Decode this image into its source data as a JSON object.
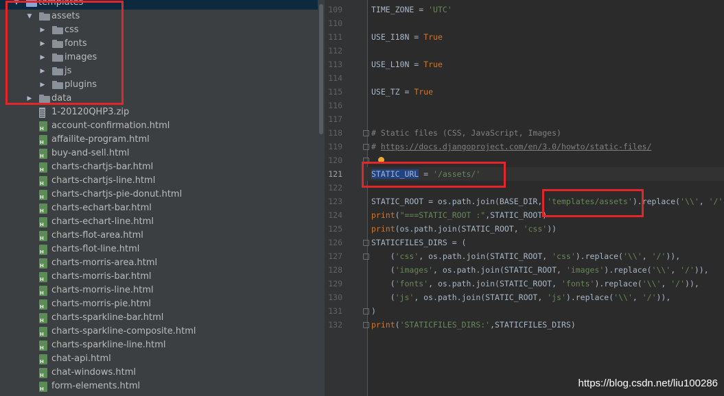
{
  "file_tree": {
    "items": [
      {
        "label": "templates",
        "type": "folder",
        "expanded": true,
        "depth": 0,
        "selected": true
      },
      {
        "label": "assets",
        "type": "folder",
        "expanded": true,
        "depth": 1
      },
      {
        "label": "css",
        "type": "folder",
        "expanded": false,
        "depth": 2
      },
      {
        "label": "fonts",
        "type": "folder",
        "expanded": false,
        "depth": 2
      },
      {
        "label": "images",
        "type": "folder",
        "expanded": false,
        "depth": 2
      },
      {
        "label": "js",
        "type": "folder",
        "expanded": false,
        "depth": 2
      },
      {
        "label": "plugins",
        "type": "folder",
        "expanded": false,
        "depth": 2
      },
      {
        "label": "data",
        "type": "folder",
        "expanded": false,
        "depth": 1
      },
      {
        "label": "1-20120QHP3.zip",
        "type": "zip",
        "depth": 1
      },
      {
        "label": "account-confirmation.html",
        "type": "html",
        "depth": 1
      },
      {
        "label": "affailite-program.html",
        "type": "html",
        "depth": 1
      },
      {
        "label": "buy-and-sell.html",
        "type": "html",
        "depth": 1
      },
      {
        "label": "charts-chartjs-bar.html",
        "type": "html",
        "depth": 1
      },
      {
        "label": "charts-chartjs-line.html",
        "type": "html",
        "depth": 1
      },
      {
        "label": "charts-chartjs-pie-donut.html",
        "type": "html",
        "depth": 1
      },
      {
        "label": "charts-echart-bar.html",
        "type": "html",
        "depth": 1
      },
      {
        "label": "charts-echart-line.html",
        "type": "html",
        "depth": 1
      },
      {
        "label": "charts-flot-area.html",
        "type": "html",
        "depth": 1
      },
      {
        "label": "charts-flot-line.html",
        "type": "html",
        "depth": 1
      },
      {
        "label": "charts-morris-area.html",
        "type": "html",
        "depth": 1
      },
      {
        "label": "charts-morris-bar.html",
        "type": "html",
        "depth": 1
      },
      {
        "label": "charts-morris-line.html",
        "type": "html",
        "depth": 1
      },
      {
        "label": "charts-morris-pie.html",
        "type": "html",
        "depth": 1
      },
      {
        "label": "charts-sparkline-bar.html",
        "type": "html",
        "depth": 1
      },
      {
        "label": "charts-sparkline-composite.html",
        "type": "html",
        "depth": 1
      },
      {
        "label": "charts-sparkline-line.html",
        "type": "html",
        "depth": 1
      },
      {
        "label": "chat-api.html",
        "type": "html",
        "depth": 1
      },
      {
        "label": "chat-windows.html",
        "type": "html",
        "depth": 1
      },
      {
        "label": "form-elements.html",
        "type": "html",
        "depth": 1
      }
    ]
  },
  "editor": {
    "current_line": "121",
    "lines": [
      {
        "num": "109",
        "tokens": [
          {
            "t": "TIME_ZONE = ",
            "c": "plain"
          },
          {
            "t": "'UTC'",
            "c": "str"
          }
        ]
      },
      {
        "num": "110",
        "tokens": []
      },
      {
        "num": "111",
        "tokens": [
          {
            "t": "USE_I18N = ",
            "c": "plain"
          },
          {
            "t": "True",
            "c": "kw"
          }
        ]
      },
      {
        "num": "112",
        "tokens": []
      },
      {
        "num": "113",
        "tokens": [
          {
            "t": "USE_L10N = ",
            "c": "plain"
          },
          {
            "t": "True",
            "c": "kw"
          }
        ]
      },
      {
        "num": "114",
        "tokens": []
      },
      {
        "num": "115",
        "tokens": [
          {
            "t": "USE_TZ = ",
            "c": "plain"
          },
          {
            "t": "True",
            "c": "kw"
          }
        ]
      },
      {
        "num": "116",
        "tokens": []
      },
      {
        "num": "117",
        "tokens": []
      },
      {
        "num": "118",
        "tokens": [
          {
            "t": "# Static files (CSS, JavaScript, Images)",
            "c": "cm"
          }
        ]
      },
      {
        "num": "119",
        "tokens": [
          {
            "t": "# ",
            "c": "cm"
          },
          {
            "t": "https://docs.djangoproject.com/en/3.0/howto/static-files/",
            "c": "lnk"
          }
        ]
      },
      {
        "num": "120",
        "tokens": []
      },
      {
        "num": "121",
        "tokens": [
          {
            "t": "STATIC_URL",
            "c": "sel"
          },
          {
            "t": " = ",
            "c": "plain"
          },
          {
            "t": "'/assets/'",
            "c": "str"
          }
        ]
      },
      {
        "num": "122",
        "tokens": []
      },
      {
        "num": "123",
        "tokens": [
          {
            "t": "STATIC_ROOT = os.path.join(BASE_DIR, ",
            "c": "plain"
          },
          {
            "t": "'templates/assets'",
            "c": "str"
          },
          {
            "t": ").replace(",
            "c": "plain"
          },
          {
            "t": "'\\\\'",
            "c": "str"
          },
          {
            "t": ", ",
            "c": "plain"
          },
          {
            "t": "'/'",
            "c": "str"
          },
          {
            "t": ")",
            "c": "plain"
          }
        ]
      },
      {
        "num": "124",
        "tokens": [
          {
            "t": "print",
            "c": "kw"
          },
          {
            "t": "(",
            "c": "plain"
          },
          {
            "t": "\"===STATIC_ROOT :\"",
            "c": "str"
          },
          {
            "t": ",STATIC_ROOT)",
            "c": "plain"
          }
        ]
      },
      {
        "num": "125",
        "tokens": [
          {
            "t": "print",
            "c": "kw"
          },
          {
            "t": "(os.path.join(STATIC_ROOT, ",
            "c": "plain"
          },
          {
            "t": "'css'",
            "c": "str"
          },
          {
            "t": "))",
            "c": "plain"
          }
        ]
      },
      {
        "num": "126",
        "tokens": [
          {
            "t": "STATICFILES_DIRS = (",
            "c": "plain"
          }
        ]
      },
      {
        "num": "127",
        "tokens": [
          {
            "t": "    (",
            "c": "plain"
          },
          {
            "t": "'css'",
            "c": "str"
          },
          {
            "t": ", os.path.join(STATIC_ROOT, ",
            "c": "plain"
          },
          {
            "t": "'css'",
            "c": "str"
          },
          {
            "t": ").replace(",
            "c": "plain"
          },
          {
            "t": "'\\\\'",
            "c": "str"
          },
          {
            "t": ", ",
            "c": "plain"
          },
          {
            "t": "'/'",
            "c": "str"
          },
          {
            "t": ")),",
            "c": "plain"
          }
        ]
      },
      {
        "num": "128",
        "tokens": [
          {
            "t": "    (",
            "c": "plain"
          },
          {
            "t": "'images'",
            "c": "str"
          },
          {
            "t": ", os.path.join(STATIC_ROOT, ",
            "c": "plain"
          },
          {
            "t": "'images'",
            "c": "str"
          },
          {
            "t": ").replace(",
            "c": "plain"
          },
          {
            "t": "'\\\\'",
            "c": "str"
          },
          {
            "t": ", ",
            "c": "plain"
          },
          {
            "t": "'/'",
            "c": "str"
          },
          {
            "t": ")),",
            "c": "plain"
          }
        ]
      },
      {
        "num": "129",
        "tokens": [
          {
            "t": "    (",
            "c": "plain"
          },
          {
            "t": "'fonts'",
            "c": "str"
          },
          {
            "t": ", os.path.join(STATIC_ROOT, ",
            "c": "plain"
          },
          {
            "t": "'fonts'",
            "c": "str"
          },
          {
            "t": ").replace(",
            "c": "plain"
          },
          {
            "t": "'\\\\'",
            "c": "str"
          },
          {
            "t": ", ",
            "c": "plain"
          },
          {
            "t": "'/'",
            "c": "str"
          },
          {
            "t": ")),",
            "c": "plain"
          }
        ]
      },
      {
        "num": "130",
        "tokens": [
          {
            "t": "    (",
            "c": "plain"
          },
          {
            "t": "'js'",
            "c": "str"
          },
          {
            "t": ", os.path.join(STATIC_ROOT, ",
            "c": "plain"
          },
          {
            "t": "'js'",
            "c": "str"
          },
          {
            "t": ").replace(",
            "c": "plain"
          },
          {
            "t": "'\\\\'",
            "c": "str"
          },
          {
            "t": ", ",
            "c": "plain"
          },
          {
            "t": "'/'",
            "c": "str"
          },
          {
            "t": ")),",
            "c": "plain"
          }
        ]
      },
      {
        "num": "131",
        "tokens": [
          {
            "t": ")",
            "c": "plain"
          }
        ]
      },
      {
        "num": "132",
        "tokens": [
          {
            "t": "print",
            "c": "kw"
          },
          {
            "t": "(",
            "c": "plain"
          },
          {
            "t": "'STATICFILES_DIRS:'",
            "c": "str"
          },
          {
            "t": ",STATICFILES_DIRS)",
            "c": "plain"
          }
        ]
      }
    ]
  },
  "watermark": "https://blog.csdn.net/liu100286",
  "colors": {
    "annotation_red": "#e4262a",
    "selection": "#214283",
    "keyword": "#cc7832",
    "string": "#6a8759",
    "comment": "#808080"
  }
}
